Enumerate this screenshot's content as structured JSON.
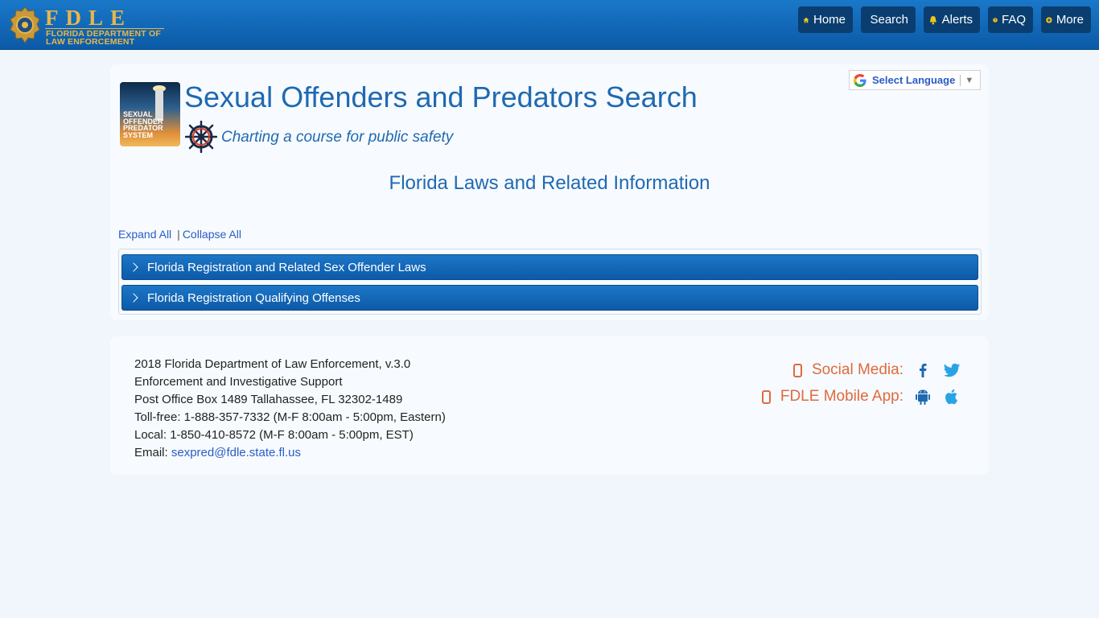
{
  "header": {
    "logo_main": "FDLE",
    "logo_sub_line1": "FLORIDA DEPARTMENT OF",
    "logo_sub_line2": "LAW ENFORCEMENT",
    "nav": [
      {
        "label": "Home",
        "icon": "home-icon"
      },
      {
        "label": "Search",
        "icon": "search-icon"
      },
      {
        "label": "Alerts",
        "icon": "bell-icon"
      },
      {
        "label": "FAQ",
        "icon": "question-icon"
      },
      {
        "label": "More",
        "icon": "plus-circle-icon"
      }
    ]
  },
  "language": {
    "label": "Select Language",
    "arrow": "▼"
  },
  "system_logo_text": [
    "SEXUAL",
    "OFFENDER",
    "PREDATOR",
    "SYSTEM"
  ],
  "site_title": "Sexual Offenders and Predators Search",
  "tagline": "Charting a course for public safety",
  "page_title": "Florida Laws and Related Information",
  "controls": {
    "expand_all": "Expand All",
    "divider": "|",
    "collapse_all": "Collapse All"
  },
  "accordion": [
    {
      "label": "Florida Registration and Related Sex Offender Laws"
    },
    {
      "label": "Florida Registration Qualifying Offenses"
    }
  ],
  "footer": {
    "lines": [
      "2018 Florida Department of Law Enforcement, v.3.0",
      "Enforcement and Investigative Support",
      "Post Office Box 1489 Tallahassee, FL 32302-1489",
      "Toll-free: 1-888-357-7332 (M-F 8:00am - 5:00pm, Eastern)",
      "Local: 1-850-410-8572 (M-F 8:00am - 5:00pm, EST)"
    ],
    "email_label": "Email:",
    "email": "sexpred@fdle.state.fl.us",
    "social_label": "Social Media:",
    "app_label": "FDLE Mobile App:"
  },
  "colors": {
    "header_blue": "#0b5aa6",
    "title_blue": "#1f69b1",
    "accent_orange": "#e06a3c",
    "gold": "#e8b64a"
  }
}
